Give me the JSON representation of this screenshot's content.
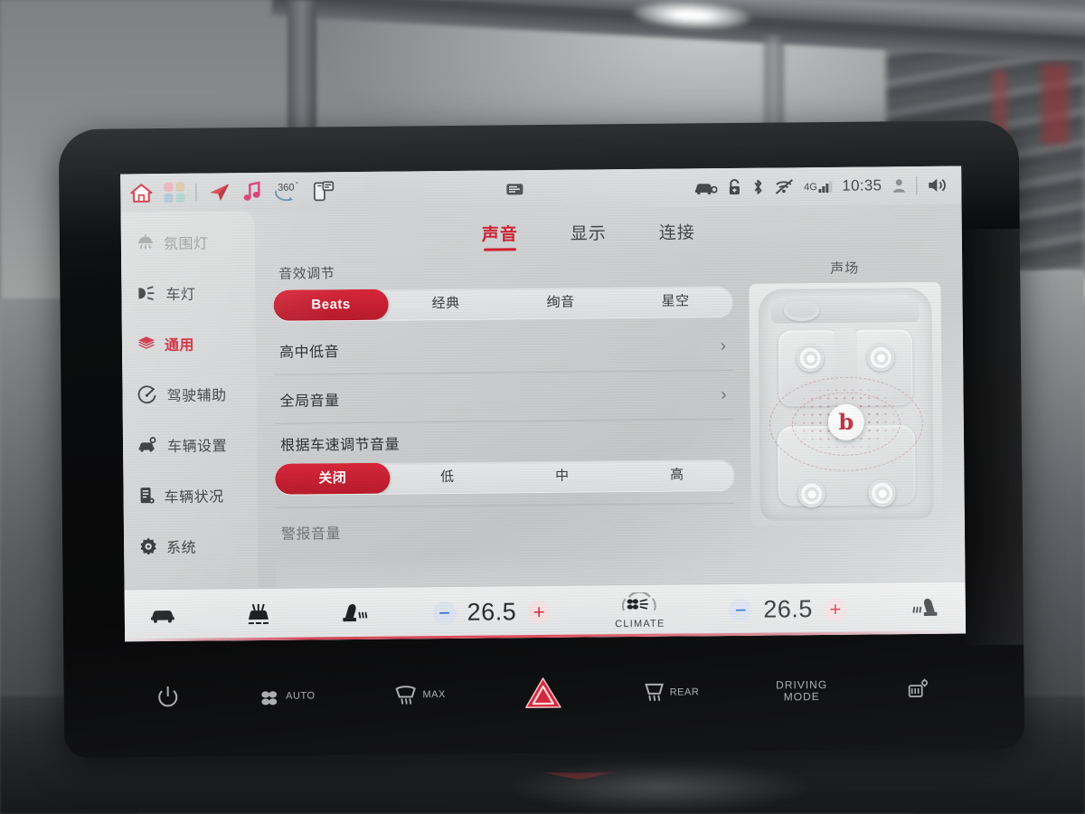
{
  "status_bar": {
    "left_icons": [
      {
        "name": "home-icon",
        "label": "home"
      },
      {
        "name": "apps-grid-icon",
        "label": "apps"
      },
      {
        "name": "navigation-icon",
        "label": "navigation"
      },
      {
        "name": "music-icon",
        "label": "music"
      },
      {
        "name": "camera-360-icon",
        "label": "360"
      },
      {
        "name": "phone-projection-icon",
        "label": "phone"
      }
    ],
    "center_icon": "media-card-icon",
    "camera_label": "360",
    "degree": "°",
    "network": "4G",
    "time": "10:35",
    "right_icons": [
      {
        "name": "car-status-icon"
      },
      {
        "name": "lock-icon"
      },
      {
        "name": "bluetooth-icon"
      },
      {
        "name": "wifi-off-icon"
      },
      {
        "name": "signal-4g-icon"
      },
      {
        "name": "user-profile-icon"
      },
      {
        "name": "volume-icon"
      }
    ]
  },
  "sidebar": {
    "items": [
      {
        "label": "氛围灯",
        "icon": "ambient-light-icon",
        "state": "dim"
      },
      {
        "label": "车灯",
        "icon": "headlight-icon",
        "state": "normal"
      },
      {
        "label": "通用",
        "icon": "layers-icon",
        "state": "active"
      },
      {
        "label": "驾驶辅助",
        "icon": "driving-assist-icon",
        "state": "normal"
      },
      {
        "label": "车辆设置",
        "icon": "vehicle-settings-icon",
        "state": "normal"
      },
      {
        "label": "车辆状况",
        "icon": "vehicle-status-icon",
        "state": "normal"
      },
      {
        "label": "系统",
        "icon": "system-gear-icon",
        "state": "normal"
      }
    ]
  },
  "tabs": [
    {
      "label": "声音",
      "active": true
    },
    {
      "label": "显示",
      "active": false
    },
    {
      "label": "连接",
      "active": false
    }
  ],
  "settings": {
    "sound_mode": {
      "title": "音效调节",
      "options": [
        "Beats",
        "经典",
        "绚音",
        "星空"
      ],
      "selected": "Beats"
    },
    "rows": [
      {
        "label": "高中低音",
        "chevron": "›"
      },
      {
        "label": "全局音量",
        "chevron": "›"
      }
    ],
    "speed_volume": {
      "title": "根据车速调节音量",
      "options": [
        "关闭",
        "低",
        "中",
        "高"
      ],
      "selected": "关闭"
    },
    "cut_off_row": "警报音量"
  },
  "sound_field": {
    "title": "声场",
    "brand": "b",
    "speakers": [
      "front-left",
      "front-right",
      "rear-left",
      "rear-right"
    ]
  },
  "climate": {
    "left_icons": [
      {
        "name": "car-defog-icon"
      },
      {
        "name": "air-vent-icon"
      },
      {
        "name": "seat-heater-left-icon"
      }
    ],
    "driver_temp": "26.5",
    "passenger_temp": "26.5",
    "minus": "−",
    "plus": "+",
    "climate_label": "CLIMATE",
    "right_icons": [
      {
        "name": "seat-heater-right-icon"
      }
    ]
  },
  "physical_buttons": [
    {
      "name": "power-button",
      "label": ""
    },
    {
      "name": "fan-auto-button",
      "label": "AUTO"
    },
    {
      "name": "defrost-max-button",
      "label": "MAX"
    },
    {
      "name": "hazard-button",
      "label": ""
    },
    {
      "name": "rear-defrost-button",
      "label": "REAR"
    },
    {
      "name": "driving-mode-button",
      "label": "DRIVING\nMODE"
    },
    {
      "name": "seat-adjust-button",
      "label": ""
    }
  ],
  "physical_labels": {
    "auto": "AUTO",
    "max": "MAX",
    "rear": "REAR",
    "driving": "DRIVING",
    "mode": "MODE"
  },
  "colors": {
    "accent_red": "#cf2031",
    "seg_red": "#c11f31",
    "screen_bg": "#cfd1d2",
    "text": "#2f3032"
  }
}
